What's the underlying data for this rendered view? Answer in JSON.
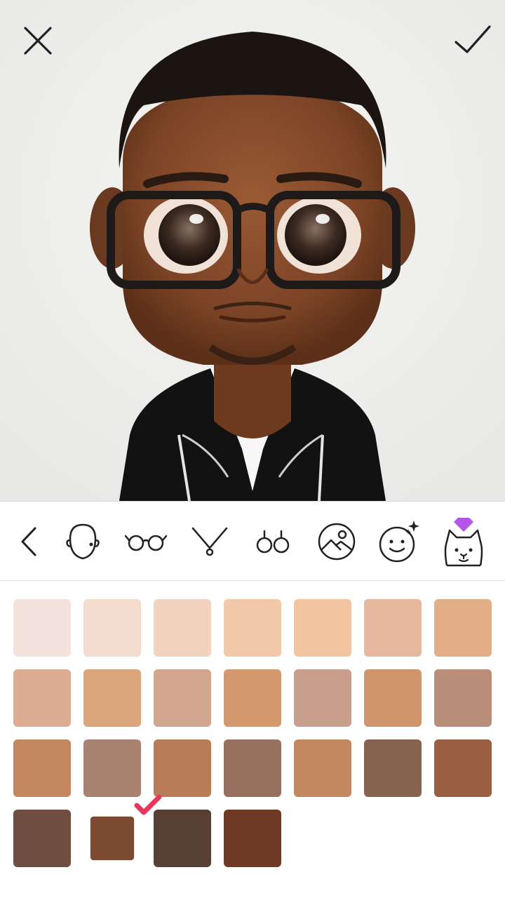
{
  "header": {
    "close_icon": "close-icon",
    "confirm_icon": "checkmark-icon"
  },
  "toolbar": {
    "tools": [
      {
        "id": "back",
        "icon": "chevron-left-icon"
      },
      {
        "id": "face",
        "icon": "face-shape-icon"
      },
      {
        "id": "glasses",
        "icon": "glasses-icon"
      },
      {
        "id": "necklace",
        "icon": "necklace-icon"
      },
      {
        "id": "earrings",
        "icon": "earrings-icon"
      },
      {
        "id": "background",
        "icon": "background-image-icon"
      },
      {
        "id": "effects",
        "icon": "sparkle-face-icon"
      },
      {
        "id": "pets",
        "icon": "cat-icon",
        "premium": true
      }
    ],
    "premium_badge_color": "#b455e6"
  },
  "palette": {
    "selected_index": 22,
    "check_color": "#e8365d",
    "swatches": [
      "#f4e3dc",
      "#f3dbcd",
      "#f2d3bf",
      "#f3c9ac",
      "#f2c49f",
      "#e7b89d",
      "#e2ae87",
      "#dcad92",
      "#dba57c",
      "#d2a58f",
      "#d6996d",
      "#c89f8d",
      "#d1956b",
      "#b88e7b",
      "#c4875f",
      "#a98271",
      "#b97c58",
      "#98705f",
      "#c5875f",
      "#87634f",
      "#9a5f41",
      "#6d4e40",
      "#7c4a30",
      "#573f33",
      "#6e3a24"
    ]
  }
}
